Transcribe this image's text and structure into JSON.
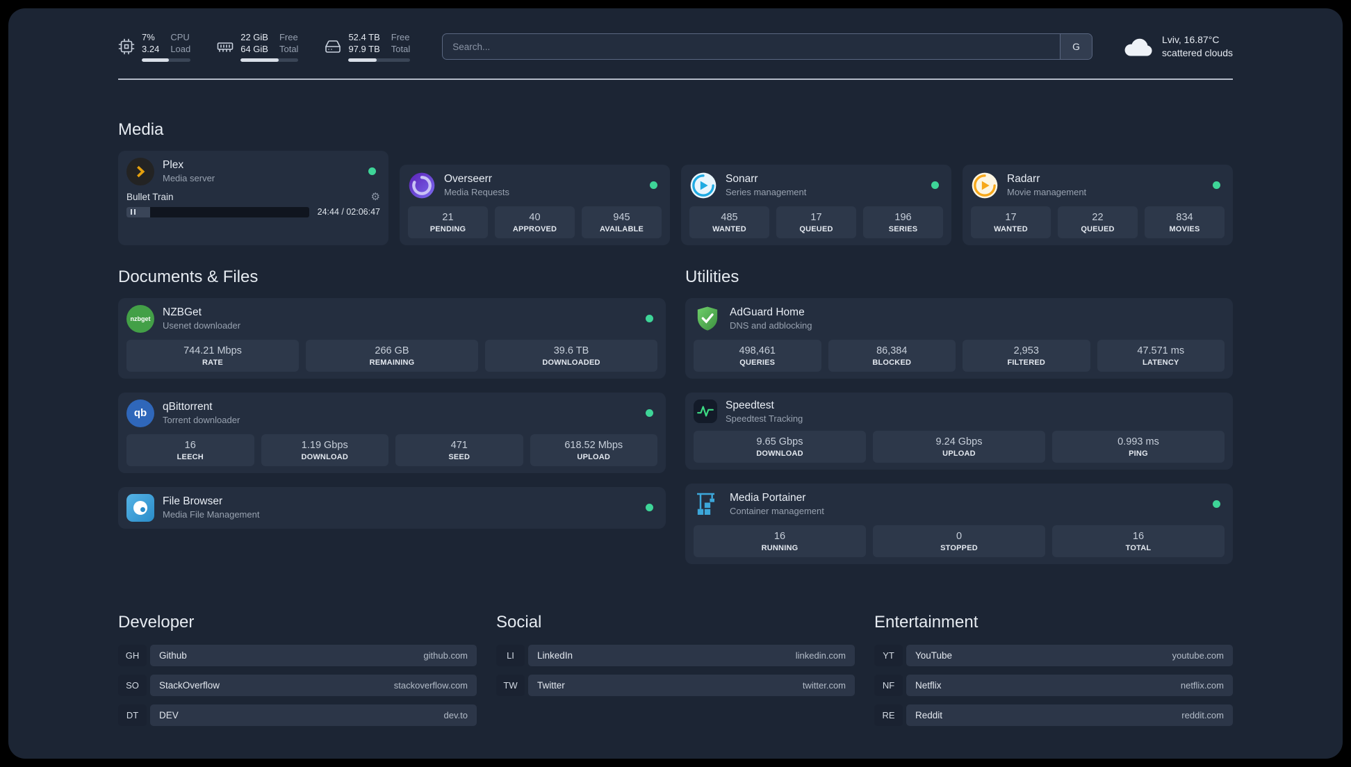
{
  "colors": {
    "status_green": "#3ed598",
    "accent_plex": "#e5a00d"
  },
  "topbar": {
    "cpu": {
      "value1": "7%",
      "value2": "3.24",
      "label1": "CPU",
      "label2": "Load",
      "progress": 55
    },
    "memory": {
      "value1": "22 GiB",
      "value2": "64 GiB",
      "label1": "Free",
      "label2": "Total",
      "progress": 66
    },
    "disk": {
      "value1": "52.4 TB",
      "value2": "97.9 TB",
      "label1": "Free",
      "label2": "Total",
      "progress": 46
    },
    "search": {
      "placeholder": "Search...",
      "button_label": "G"
    },
    "weather": {
      "location": "Lviv, 16.87°C",
      "condition": "scattered clouds"
    }
  },
  "sections": {
    "media_title": "Media",
    "documents_title": "Documents & Files",
    "utilities_title": "Utilities"
  },
  "services": {
    "plex": {
      "name": "Plex",
      "subtitle": "Media server",
      "now_playing": "Bullet Train",
      "time": "24:44 / 02:06:47"
    },
    "overseerr": {
      "name": "Overseerr",
      "subtitle": "Media Requests",
      "stats": [
        {
          "value": "21",
          "label": "PENDING"
        },
        {
          "value": "40",
          "label": "APPROVED"
        },
        {
          "value": "945",
          "label": "AVAILABLE"
        }
      ]
    },
    "sonarr": {
      "name": "Sonarr",
      "subtitle": "Series management",
      "stats": [
        {
          "value": "485",
          "label": "WANTED"
        },
        {
          "value": "17",
          "label": "QUEUED"
        },
        {
          "value": "196",
          "label": "SERIES"
        }
      ]
    },
    "radarr": {
      "name": "Radarr",
      "subtitle": "Movie management",
      "stats": [
        {
          "value": "17",
          "label": "WANTED"
        },
        {
          "value": "22",
          "label": "QUEUED"
        },
        {
          "value": "834",
          "label": "MOVIES"
        }
      ]
    },
    "nzbget": {
      "name": "NZBGet",
      "subtitle": "Usenet downloader",
      "icon_text": "nzbget",
      "stats": [
        {
          "value": "744.21 Mbps",
          "label": "RATE"
        },
        {
          "value": "266 GB",
          "label": "REMAINING"
        },
        {
          "value": "39.6 TB",
          "label": "DOWNLOADED"
        }
      ]
    },
    "qbittorrent": {
      "name": "qBittorrent",
      "subtitle": "Torrent downloader",
      "icon_text": "qb",
      "stats": [
        {
          "value": "16",
          "label": "LEECH"
        },
        {
          "value": "1.19 Gbps",
          "label": "DOWNLOAD"
        },
        {
          "value": "471",
          "label": "SEED"
        },
        {
          "value": "618.52 Mbps",
          "label": "UPLOAD"
        }
      ]
    },
    "filebrowser": {
      "name": "File Browser",
      "subtitle": "Media File Management"
    },
    "adguard": {
      "name": "AdGuard Home",
      "subtitle": "DNS and adblocking",
      "stats": [
        {
          "value": "498,461",
          "label": "QUERIES"
        },
        {
          "value": "86,384",
          "label": "BLOCKED"
        },
        {
          "value": "2,953",
          "label": "FILTERED"
        },
        {
          "value": "47.571 ms",
          "label": "LATENCY"
        }
      ]
    },
    "speedtest": {
      "name": "Speedtest",
      "subtitle": "Speedtest Tracking",
      "stats": [
        {
          "value": "9.65 Gbps",
          "label": "DOWNLOAD"
        },
        {
          "value": "9.24 Gbps",
          "label": "UPLOAD"
        },
        {
          "value": "0.993 ms",
          "label": "PING"
        }
      ]
    },
    "portainer": {
      "name": "Media Portainer",
      "subtitle": "Container management",
      "stats": [
        {
          "value": "16",
          "label": "RUNNING"
        },
        {
          "value": "0",
          "label": "STOPPED"
        },
        {
          "value": "16",
          "label": "TOTAL"
        }
      ]
    }
  },
  "bookmarks": {
    "groups": [
      {
        "title": "Developer",
        "items": [
          {
            "abbr": "GH",
            "name": "Github",
            "url": "github.com"
          },
          {
            "abbr": "SO",
            "name": "StackOverflow",
            "url": "stackoverflow.com"
          },
          {
            "abbr": "DT",
            "name": "DEV",
            "url": "dev.to"
          }
        ]
      },
      {
        "title": "Social",
        "items": [
          {
            "abbr": "LI",
            "name": "LinkedIn",
            "url": "linkedin.com"
          },
          {
            "abbr": "TW",
            "name": "Twitter",
            "url": "twitter.com"
          }
        ]
      },
      {
        "title": "Entertainment",
        "items": [
          {
            "abbr": "YT",
            "name": "YouTube",
            "url": "youtube.com"
          },
          {
            "abbr": "NF",
            "name": "Netflix",
            "url": "netflix.com"
          },
          {
            "abbr": "RE",
            "name": "Reddit",
            "url": "reddit.com"
          }
        ]
      }
    ]
  }
}
